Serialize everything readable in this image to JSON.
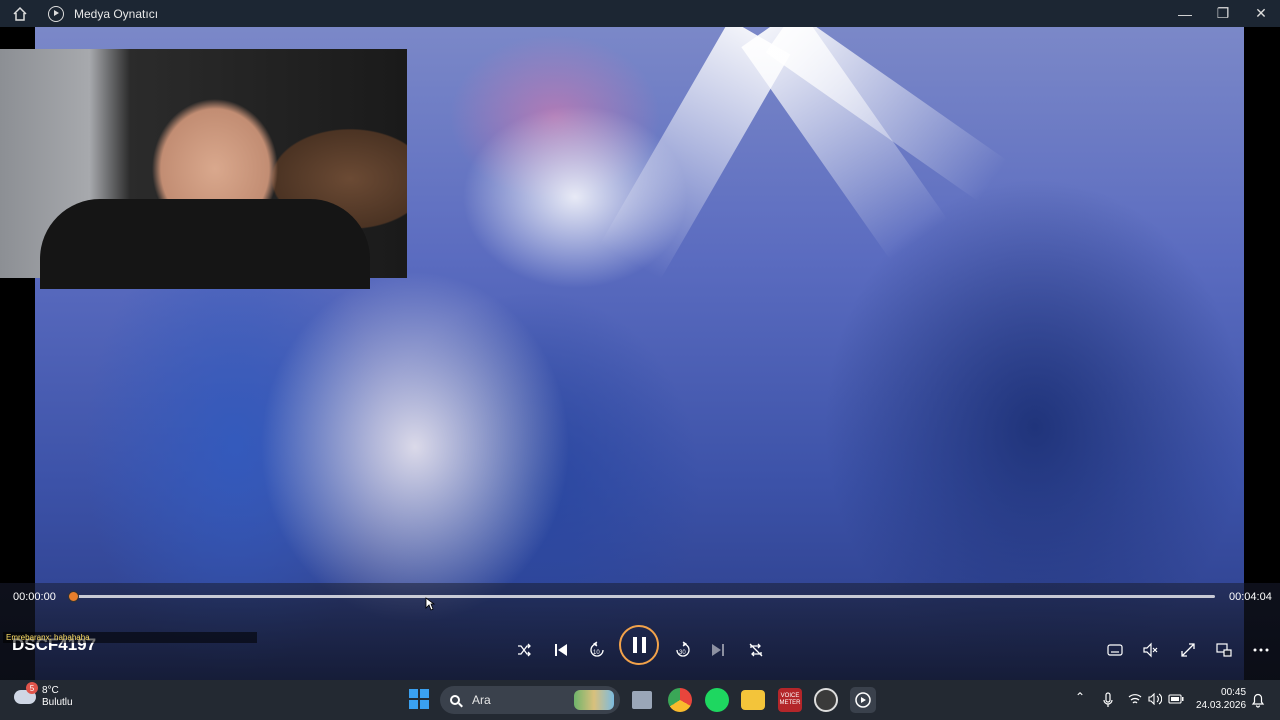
{
  "window": {
    "title": "Medya Oynatıcı",
    "controls": [
      "—",
      "❐",
      "✕"
    ]
  },
  "overlay": {
    "chat_text": "Emrebaranx: hahahaha"
  },
  "player": {
    "file_title": "DSCF4197",
    "current_time": "00:00:00",
    "total_time": "00:04:04",
    "progress": 0.0,
    "accent_color": "#e87e2c"
  },
  "taskbar": {
    "weather_temp": "8°C",
    "weather_desc": "Bulutlu",
    "weather_badge": "5",
    "search_placeholder": "Ara",
    "voicemeeter_label": "VOICE METER",
    "time": "00:45",
    "date": "24.03.2026"
  }
}
